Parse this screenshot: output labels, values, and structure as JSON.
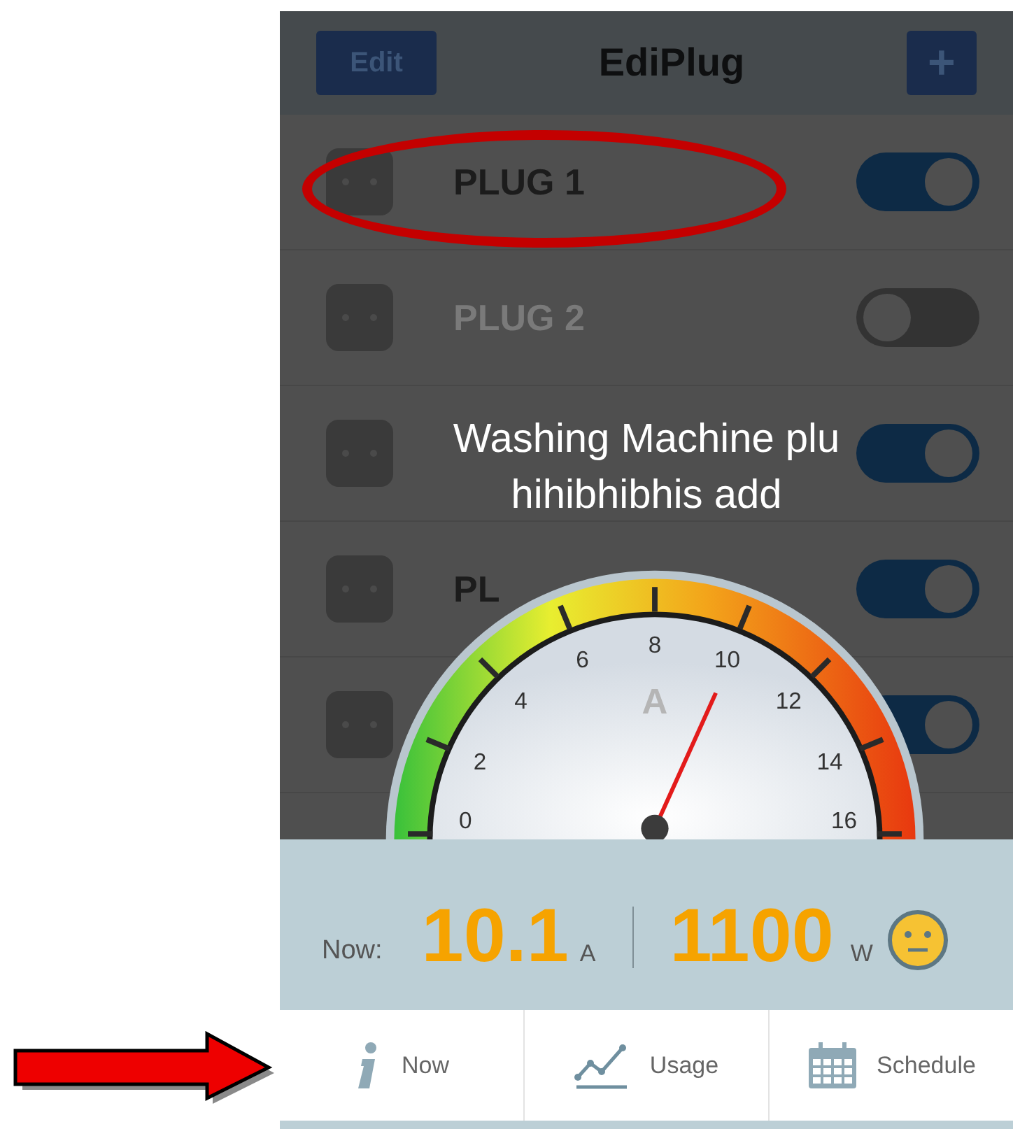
{
  "header": {
    "edit_button": "Edit",
    "title": "EdiPlug",
    "add_button": "+"
  },
  "plugs": [
    {
      "name": "PLUG 1",
      "on": true
    },
    {
      "name": "PLUG 2",
      "on": false
    },
    {
      "on": true
    },
    {
      "name": "PL",
      "on": true
    },
    {
      "on": true
    }
  ],
  "caption": "Washing Machine plu hihibhibhis add",
  "gauge": {
    "ticks": [
      "0",
      "2",
      "4",
      "6",
      "8",
      "10",
      "12",
      "14",
      "16"
    ],
    "unit": "A",
    "level": 0.63
  },
  "readings": {
    "label": "Now:",
    "current": "10.1",
    "current_unit": "A",
    "power": "1100",
    "power_unit": "W"
  },
  "tabs": [
    {
      "label": "Now"
    },
    {
      "label": "Usage"
    },
    {
      "label": "Schedule"
    }
  ]
}
